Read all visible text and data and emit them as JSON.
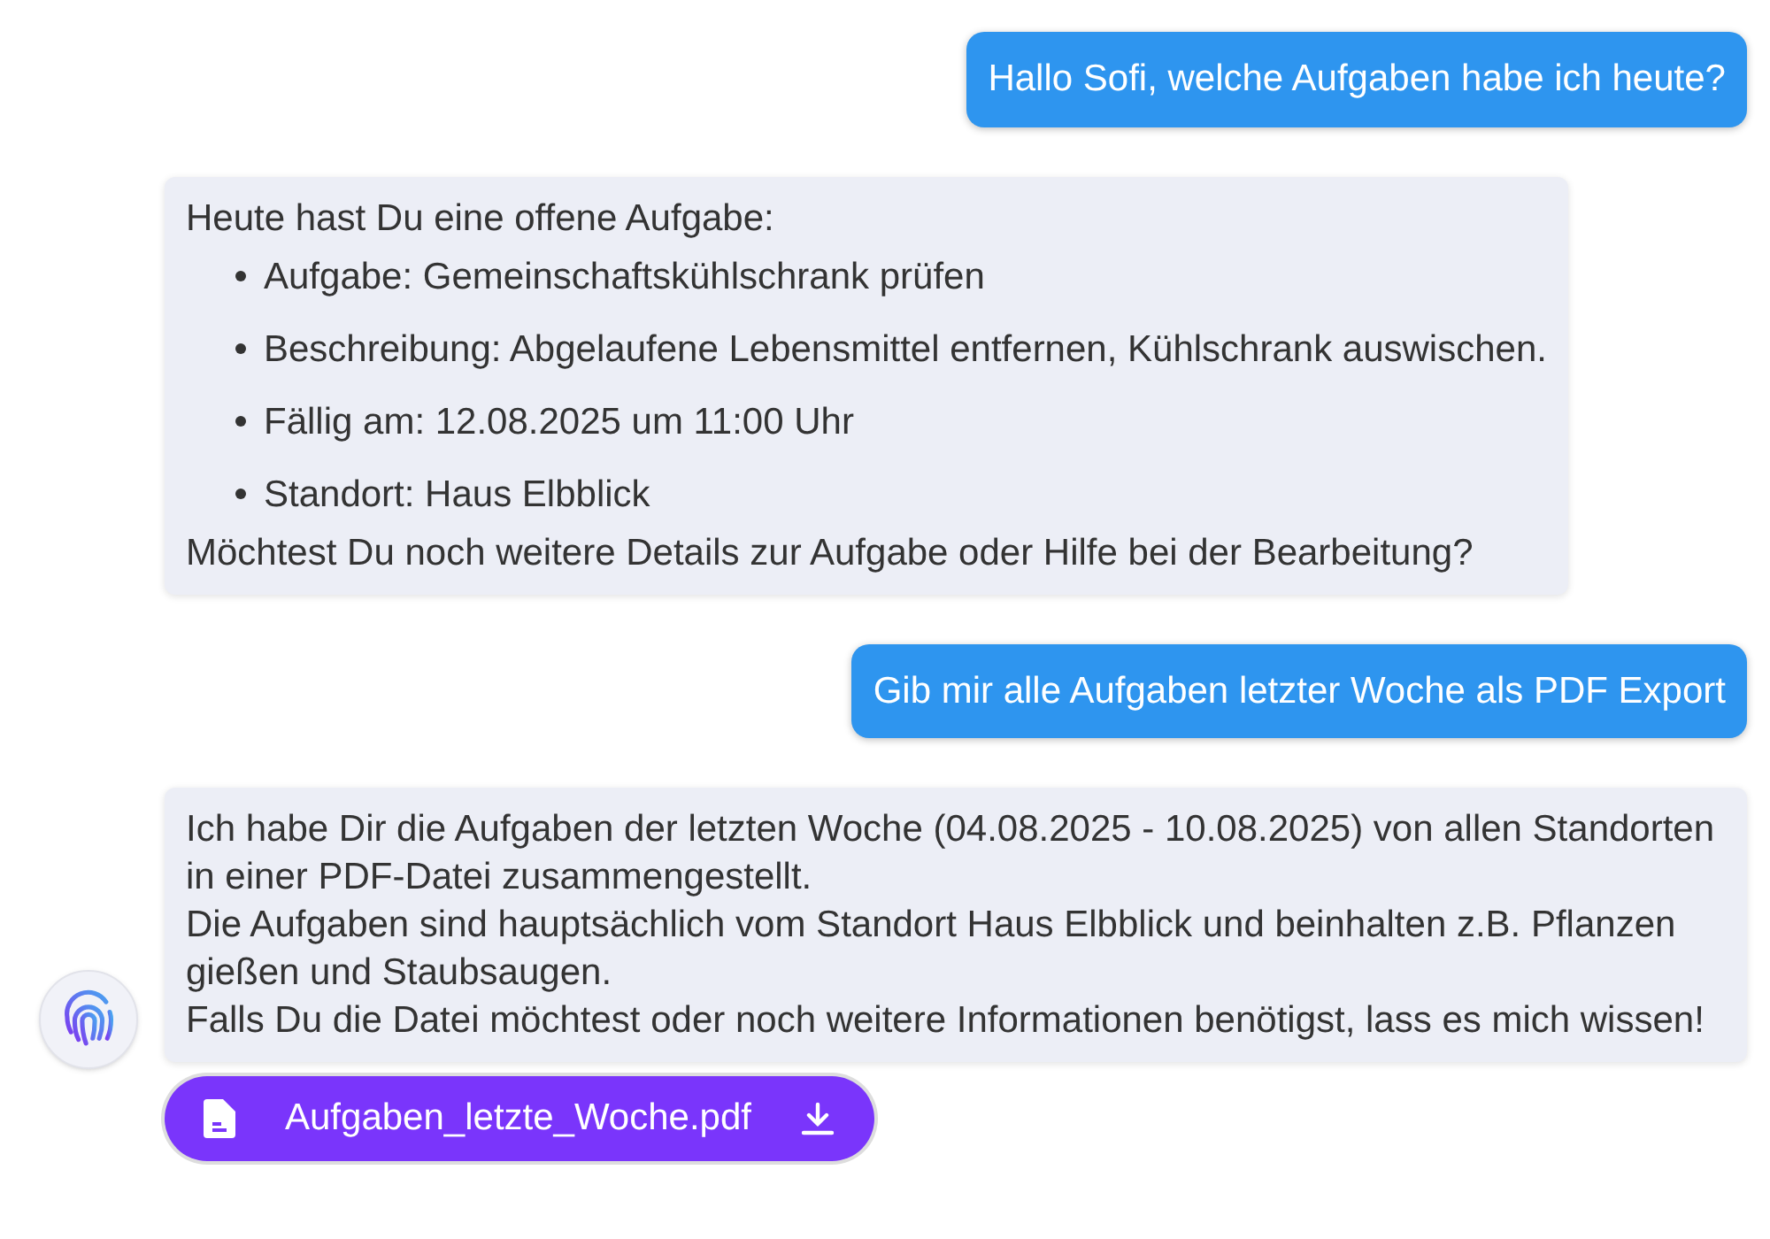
{
  "messages": [
    {
      "kind": "user",
      "text": "Hallo Sofi, welche Aufgaben habe ich heute?"
    },
    {
      "kind": "assistant",
      "avatar": false,
      "blocks": [
        {
          "kind": "text",
          "text": "Heute hast Du eine offene Aufgabe:"
        },
        {
          "kind": "list",
          "items": [
            "Aufgabe: Gemeinschaftskühlschrank prüfen",
            "Beschreibung: Abgelaufene Lebensmittel entfernen, Kühlschrank auswischen.",
            "Fällig am: 12.08.2025 um 11:00 Uhr",
            "Standort: Haus Elbblick"
          ]
        },
        {
          "kind": "text",
          "text": "Möchtest Du noch weitere Details zur Aufgabe oder Hilfe bei der Bearbeitung?"
        }
      ]
    },
    {
      "kind": "user",
      "text": "Gib mir alle Aufgaben letzter Woche als PDF Export"
    },
    {
      "kind": "assistant",
      "avatar": true,
      "blocks": [
        {
          "kind": "text",
          "text": "Ich habe Dir die Aufgaben der letzten Woche (04.08.2025 - 10.08.2025) von allen Standorten in einer PDF-Datei zusammengestellt."
        },
        {
          "kind": "text",
          "text": "Die Aufgaben sind hauptsächlich vom Standort Haus Elbblick und beinhalten z.B. Pflanzen gießen und Staubsaugen."
        },
        {
          "kind": "text",
          "text": "Falls Du die Datei möchtest oder noch weitere Informationen benötigst, lass es mich wissen!"
        }
      ],
      "attachment": {
        "filename": "Aufgaben_letzte_Woche.pdf"
      }
    }
  ]
}
